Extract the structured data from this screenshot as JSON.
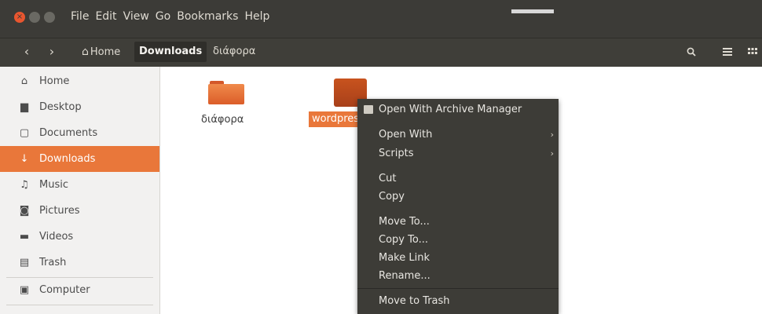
{
  "menubar": {
    "items": [
      "File",
      "Edit",
      "View",
      "Go",
      "Bookmarks",
      "Help"
    ]
  },
  "toolbar": {
    "back": "‹",
    "forward": "›",
    "breadcrumbs": [
      {
        "label": "Home"
      },
      {
        "label": "Downloads"
      },
      {
        "label": "διάφορα"
      }
    ]
  },
  "sidebar": {
    "items": [
      {
        "label": "Home",
        "icon": "home-icon"
      },
      {
        "label": "Desktop",
        "icon": "desktop-icon"
      },
      {
        "label": "Documents",
        "icon": "document-icon"
      },
      {
        "label": "Downloads",
        "icon": "download-icon",
        "active": true
      },
      {
        "label": "Music",
        "icon": "music-icon"
      },
      {
        "label": "Pictures",
        "icon": "camera-icon"
      },
      {
        "label": "Videos",
        "icon": "video-icon"
      },
      {
        "label": "Trash",
        "icon": "trash-icon"
      },
      {
        "label": "Computer",
        "icon": "computer-icon"
      }
    ]
  },
  "content": {
    "items": [
      {
        "label": "διάφορα",
        "type": "folder"
      },
      {
        "label": "wordpress",
        "type": "archive",
        "selected": true
      }
    ]
  },
  "context_menu": {
    "items": [
      "Open With Archive Manager",
      "Open With",
      "Scripts",
      "Cut",
      "Copy",
      "Move To...",
      "Copy To...",
      "Make Link",
      "Rename...",
      "Move to Trash"
    ]
  },
  "colors": {
    "accent": "#e9773a",
    "titlebar": "#3c3b37",
    "menu_bg": "#3d3c37",
    "close_button": "#e9562f"
  }
}
